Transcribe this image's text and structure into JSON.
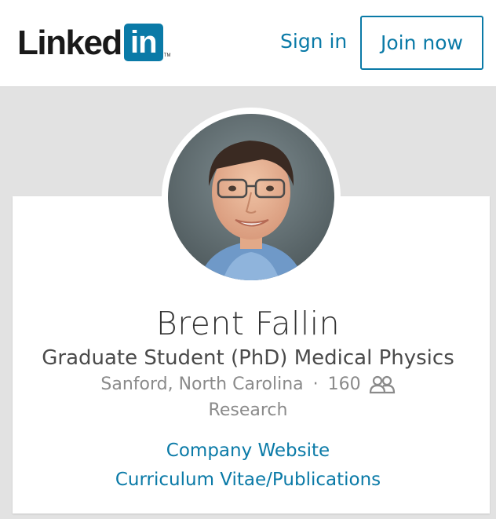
{
  "header": {
    "logo_text": "Linked",
    "logo_box": "in",
    "logo_tm": "TM",
    "signin_label": "Sign in",
    "joinnow_label": "Join now"
  },
  "profile": {
    "name": "Brent Fallin",
    "headline": "Graduate Student (PhD) Medical Physics",
    "location": "Sanford, North Carolina",
    "separator": "·",
    "connections": "160",
    "connections_icon": "people-icon",
    "industry": "Research",
    "links": [
      {
        "label": "Company Website"
      },
      {
        "label": "Curriculum Vitae/Publications"
      }
    ]
  },
  "colors": {
    "brand": "#0a7aa7",
    "background": "#e2e2e2",
    "text_dark": "#333333",
    "text_muted": "#8a8a8a"
  }
}
